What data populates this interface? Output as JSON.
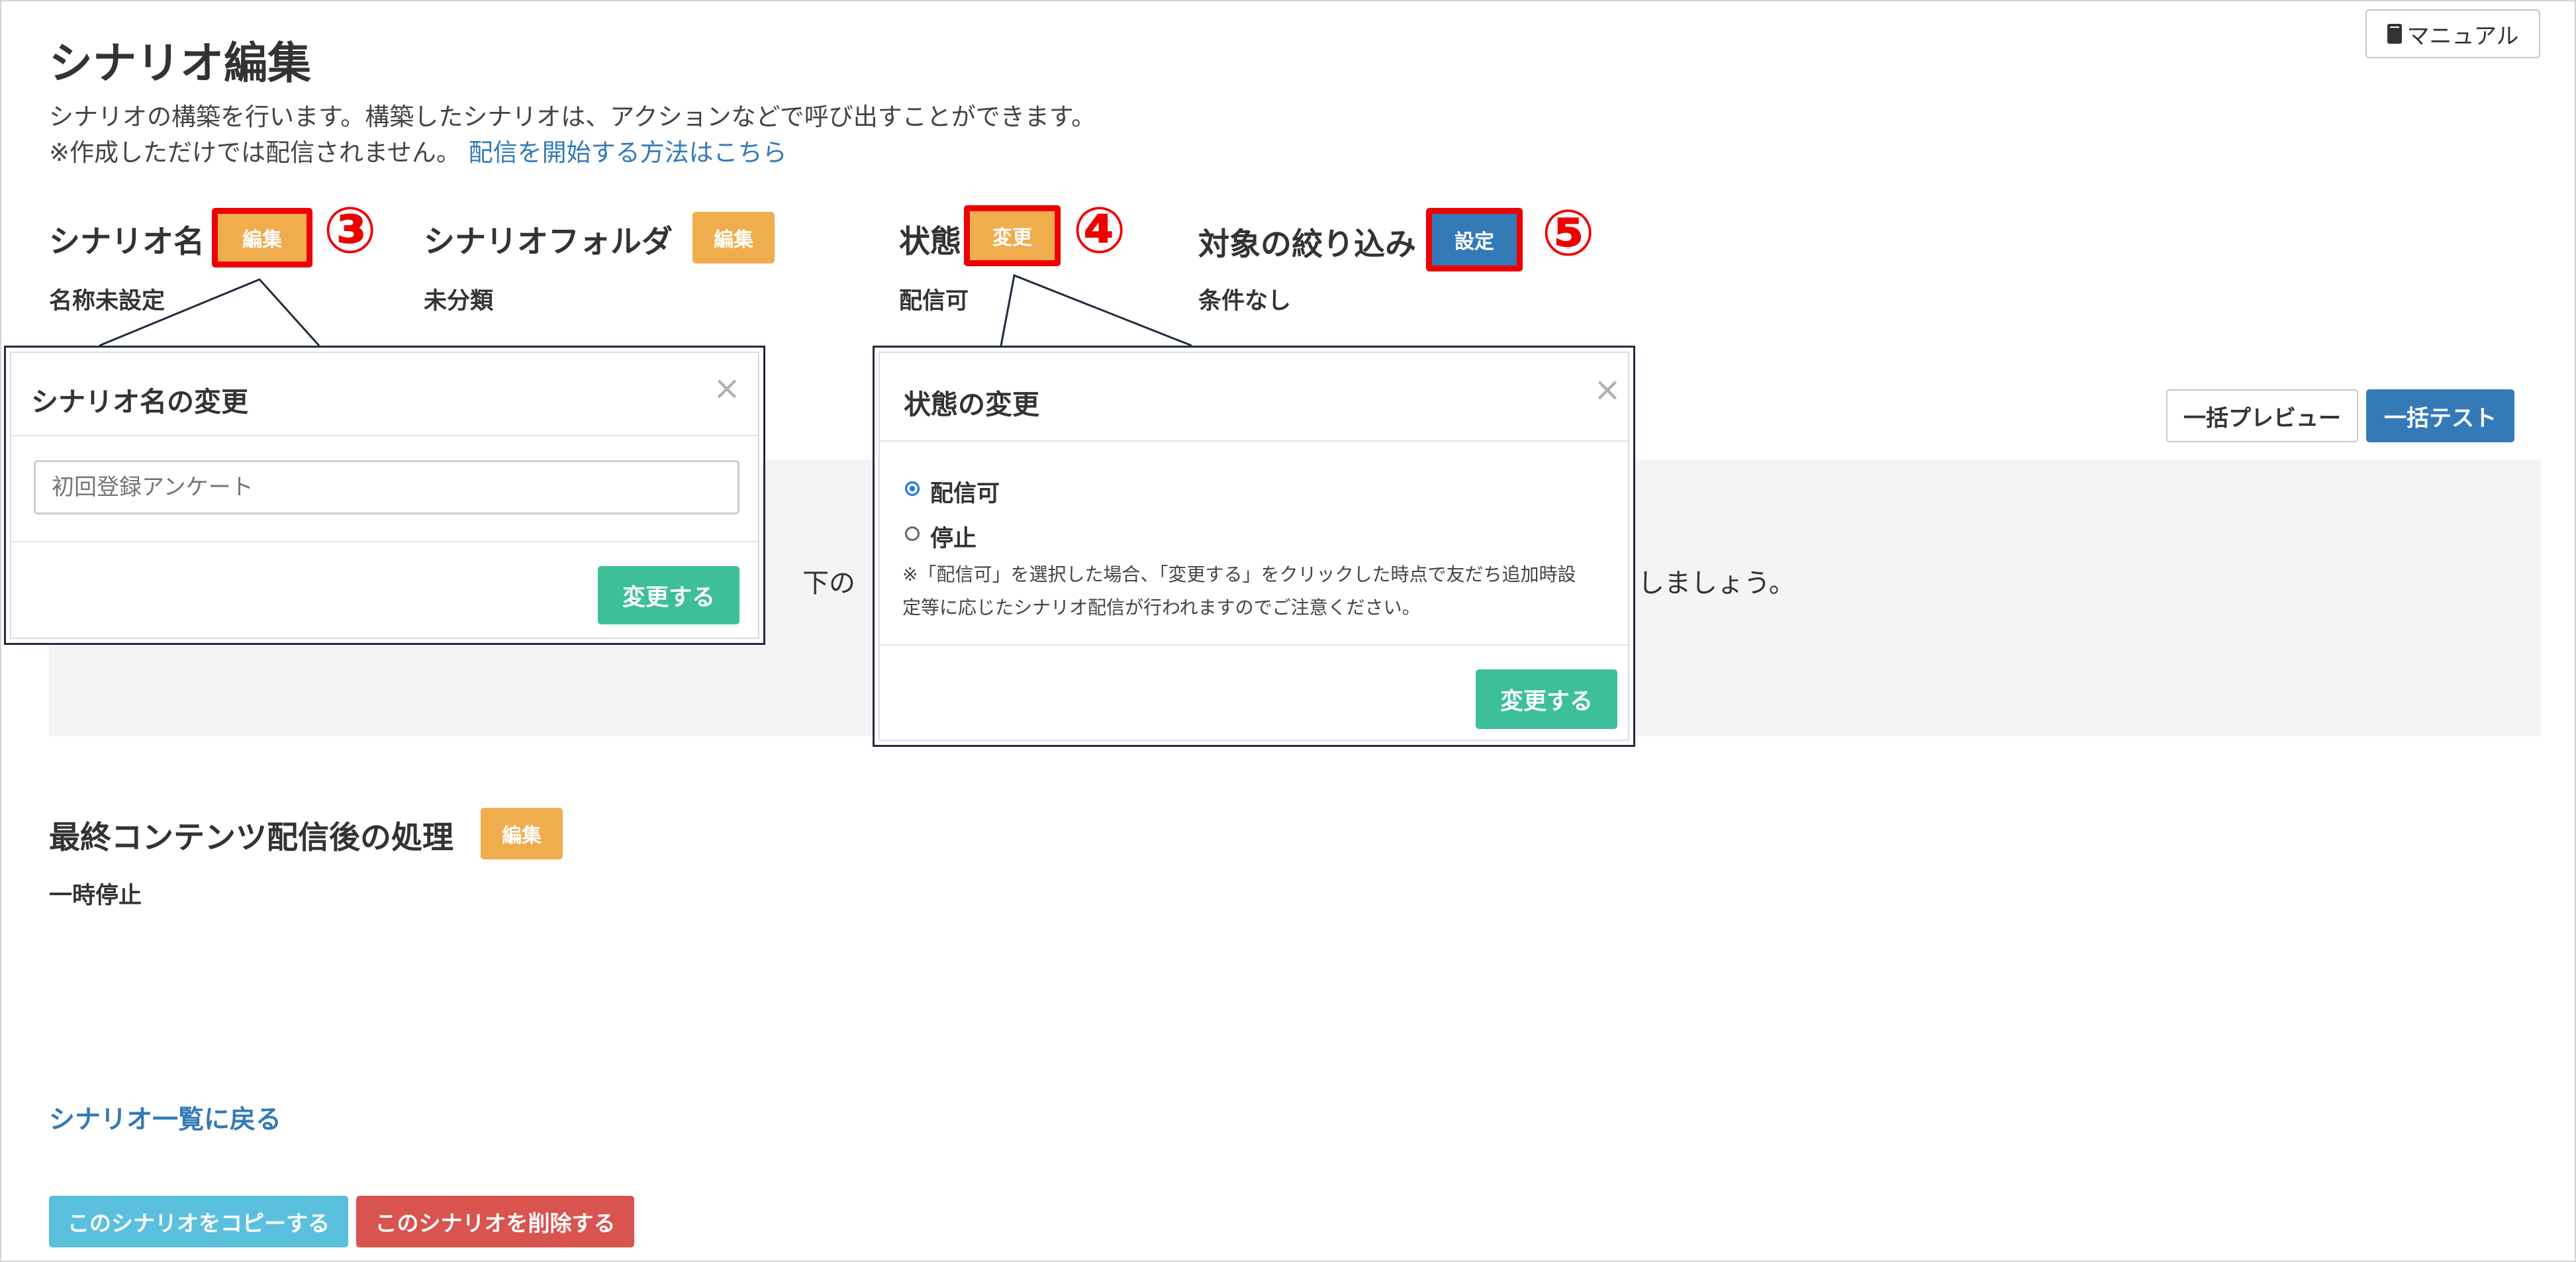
{
  "header": {
    "manual_label": "マニュアル",
    "title": "シナリオ編集",
    "desc_line1": "シナリオの構築を行います。構築したシナリオは、アクションなどで呼び出すことができます。",
    "desc_line2_prefix": "※作成しただけでは配信されません。",
    "desc_line2_link": "配信を開始する方法はこちら"
  },
  "sections": {
    "scenario_name": {
      "title": "シナリオ名",
      "button": "編集",
      "value": "名称未設定",
      "marker": "③"
    },
    "scenario_folder": {
      "title": "シナリオフォルダ",
      "button": "編集",
      "value": "未分類"
    },
    "status": {
      "title": "状態",
      "button": "変更",
      "value": "配信可",
      "marker": "④"
    },
    "target_filter": {
      "title": "対象の絞り込み",
      "button": "設定",
      "value": "条件なし",
      "marker": "⑤"
    },
    "after_last": {
      "title": "最終コンテンツ配信後の処理",
      "button": "編集",
      "value": "一時停止"
    }
  },
  "toolbar": {
    "bulk_preview": "一括プレビュー",
    "bulk_test": "一括テスト"
  },
  "panel": {
    "text_left": "下の",
    "text_right": "しましょう。"
  },
  "name_modal": {
    "title": "シナリオ名の変更",
    "close": "×",
    "input_placeholder": "初回登録アンケート",
    "submit": "変更する"
  },
  "status_modal": {
    "title": "状態の変更",
    "close": "×",
    "options": [
      "配信可",
      "停止"
    ],
    "selected": "配信可",
    "note_line1": "※「配信可」を選択した場合、「変更する」をクリックした時点で友だち追加時設",
    "note_line2": "定等に応じたシナリオ配信が行われますのでご注意ください。",
    "submit": "変更する"
  },
  "footer": {
    "back_link": "シナリオ一覧に戻る",
    "copy_button": "このシナリオをコピーする",
    "delete_button": "このシナリオを削除する"
  },
  "colors": {
    "warning": "#f0ad4e",
    "primary": "#337ab7",
    "success": "#3dbf9a",
    "info": "#5bc0de",
    "danger": "#d9534f",
    "highlight": "#ee0000"
  }
}
